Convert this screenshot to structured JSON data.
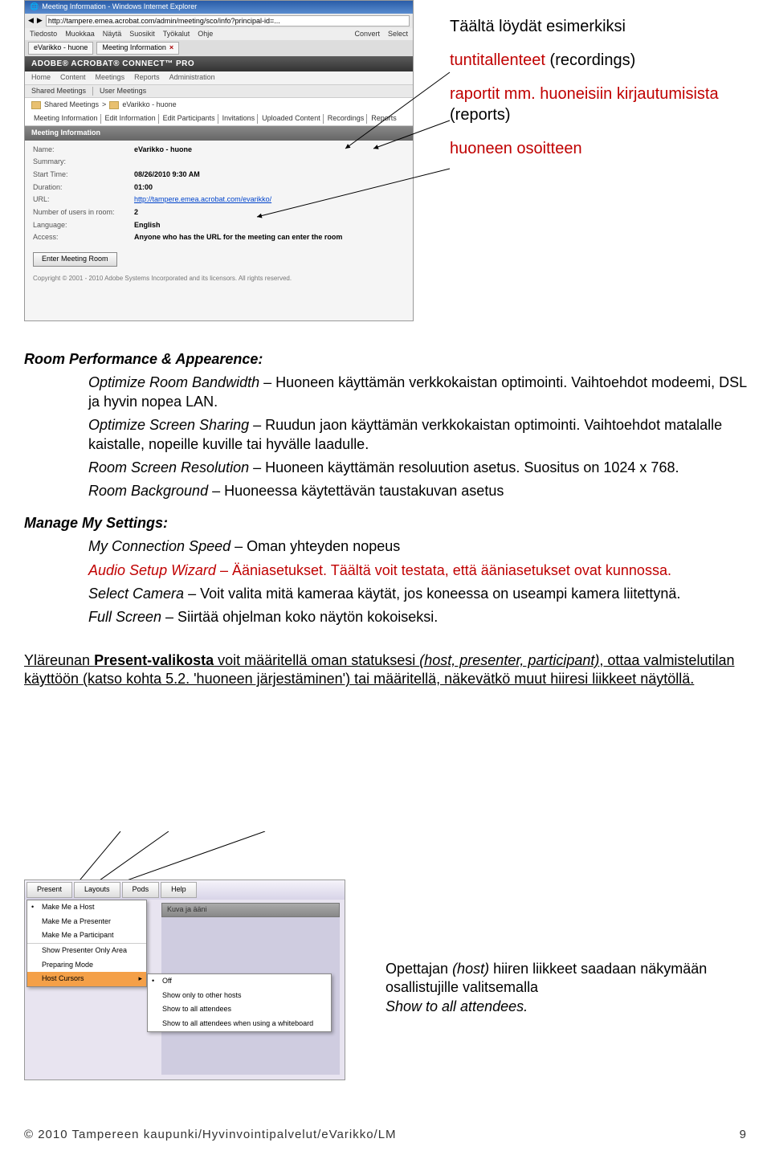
{
  "side": {
    "line1": "Täältä löydät esimerkiksi",
    "line2a": "tuntitallenteet ",
    "line2b": "(recordings)",
    "line3a": "raportit mm. huoneisiin kirjautumisista ",
    "line3b": "(reports)",
    "line4": "huoneen osoitteen"
  },
  "ie": {
    "title": "Meeting Information - Windows Internet Explorer",
    "url": "http://tampere.emea.acrobat.com/admin/meeting/sco/info?principal-id=...",
    "menus": [
      "Tiedosto",
      "Muokkaa",
      "Näytä",
      "Suosikit",
      "Työkalut",
      "Ohje"
    ],
    "convert": "Convert",
    "select": "Select",
    "tabs": [
      "eVarikko - huone",
      "Meeting Information"
    ]
  },
  "acrobat": {
    "brand": "ADOBE® ACROBAT® CONNECT™ PRO",
    "nav": [
      "Home",
      "Content",
      "Meetings",
      "Reports",
      "Administration"
    ],
    "subnav": [
      "Shared Meetings",
      "User Meetings"
    ],
    "crumb1": "Shared Meetings",
    "crumb2": "eVarikko - huone",
    "tabs2": [
      "Meeting Information",
      "Edit Information",
      "Edit Participants",
      "Invitations",
      "Uploaded Content",
      "Recordings",
      "Reports"
    ],
    "sectionTitle": "Meeting Information",
    "fields": {
      "name_l": "Name:",
      "name_v": "eVarikko - huone",
      "summary_l": "Summary:",
      "summary_v": "",
      "start_l": "Start Time:",
      "start_v": "08/26/2010 9:30 AM",
      "dur_l": "Duration:",
      "dur_v": "01:00",
      "url_l": "URL:",
      "url_v": "http://tampere.emea.acrobat.com/evarikko/",
      "num_l": "Number of users in room:",
      "num_v": "2",
      "lang_l": "Language:",
      "lang_v": "English",
      "access_l": "Access:",
      "access_v": "Anyone who has the URL for the meeting can enter the room"
    },
    "enter": "Enter Meeting Room",
    "copyright": "Copyright © 2001 - 2010 Adobe Systems Incorporated and its licensors. All rights reserved."
  },
  "doc": {
    "perf_title": "Room Performance & Appearence:",
    "perf_1a": "Optimize Room Bandwidth",
    "perf_1b": " – Huoneen käyttämän verkkokaistan optimointi. Vaihtoehdot modeemi, DSL ja hyvin nopea LAN.",
    "perf_2a": "Optimize Screen Sharing",
    "perf_2b": " – Ruudun jaon käyttämän verkkokaistan optimointi. Vaihtoehdot matalalle kaistalle, nopeille kuville tai hyvälle laadulle.",
    "perf_3a": "Room Screen Resolution",
    "perf_3b": " – Huoneen käyttämän resoluution asetus. Suositus on 1024 x 768.",
    "perf_4a": "Room Background",
    "perf_4b": " – Huoneessa käytettävän taustakuvan asetus",
    "mms_title": "Manage My Settings:",
    "mms_1a": "My Connection Speed",
    "mms_1b": " – Oman yhteyden nopeus",
    "mms_2a": "Audio Setup Wizard",
    "mms_2b": " – Ääniasetukset. Täältä voit testata, että ääniasetukset ovat kunnossa.",
    "mms_3a": "Select Camera",
    "mms_3b": " – Voit valita mitä kameraa käytät, jos koneessa on useampi kamera liitettynä.",
    "mms_4a": "Full Screen",
    "mms_4b": " – Siirtää ohjelman koko näytön kokoiseksi.",
    "present_para_a": "Yläreunan ",
    "present_para_b": "Present-valikosta",
    "present_para_c": " voit määritellä oman statuksesi ",
    "present_para_d": "(host, presenter, participant)",
    "present_para_e": ", ottaa valmistelutilan käyttöön (katso kohta 5.2. 'huoneen järjestäminen') tai määritellä, näkevätkö muut hiiresi liikkeet näytöllä."
  },
  "present": {
    "bar": [
      "Present",
      "Layouts",
      "Pods",
      "Help"
    ],
    "menu": [
      "Make Me a Host",
      "Make Me a Presenter",
      "Make Me a Participant",
      "Show Presenter Only Area",
      "Preparing Mode",
      "Host Cursors"
    ],
    "submenu": [
      "Off",
      "Show only to other hosts",
      "Show to all attendees",
      "Show to all attendees when using a whiteboard"
    ],
    "pod": "Kuva ja ääni"
  },
  "lowerRight": {
    "l1a": "Opettajan ",
    "l1b": "(host)",
    "l1c": " hiiren liikkeet saadaan näkymään osallistujille valitsemalla ",
    "l2": "Show to all attendees."
  },
  "footer": {
    "left": "© 2010 Tampereen kaupunki/Hyvinvointipalvelut/eVarikko/LM",
    "right": "9"
  }
}
